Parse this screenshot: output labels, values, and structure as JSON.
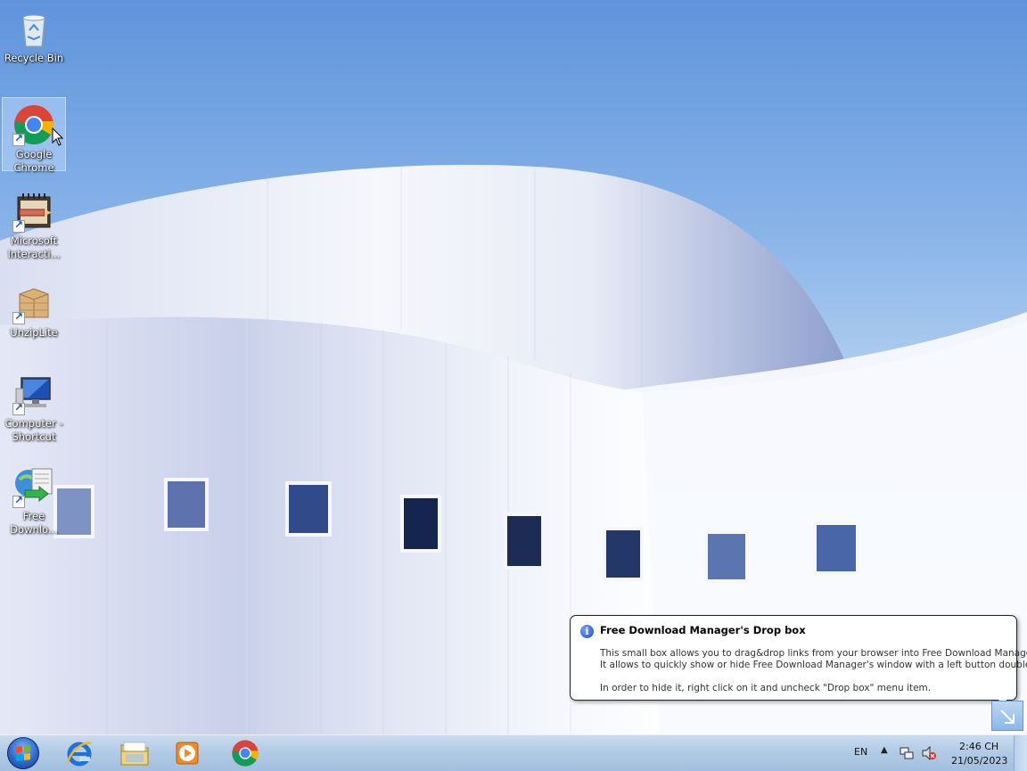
{
  "desktop": {
    "icons": [
      {
        "label": "Recycle Bin"
      },
      {
        "label": "Google Chrome"
      },
      {
        "label": "Microsoft Interacti..."
      },
      {
        "label": "UnzipLite"
      },
      {
        "label": "Computer - Shortcut"
      },
      {
        "label": "Free Downlo..."
      }
    ],
    "selected_icon": "Google Chrome"
  },
  "balloon": {
    "title": "Free Download Manager's Drop box",
    "line1": "This small box allows you to drag&drop links from your browser into Free Download Manager.",
    "line2": "It allows to quickly show or hide Free Download Manager's window with a left button double click.",
    "line3": "In order to hide it, right click on it and uncheck \"Drop box\" menu item.",
    "icon": "info-icon"
  },
  "taskbar": {
    "pinned": [
      {
        "name": "Internet Explorer",
        "icon": "internet-explorer-icon"
      },
      {
        "name": "Windows Explorer",
        "icon": "folder-icon"
      },
      {
        "name": "Windows Media Player",
        "icon": "media-player-icon"
      },
      {
        "name": "Google Chrome",
        "icon": "chrome-icon"
      }
    ],
    "tray": {
      "language": "EN",
      "time": "2:46 CH",
      "date": "21/05/2023"
    }
  },
  "colors": {
    "sky_top": "#5f93db",
    "taskbar": "#b2cbe6",
    "building": "#eef1f8"
  }
}
